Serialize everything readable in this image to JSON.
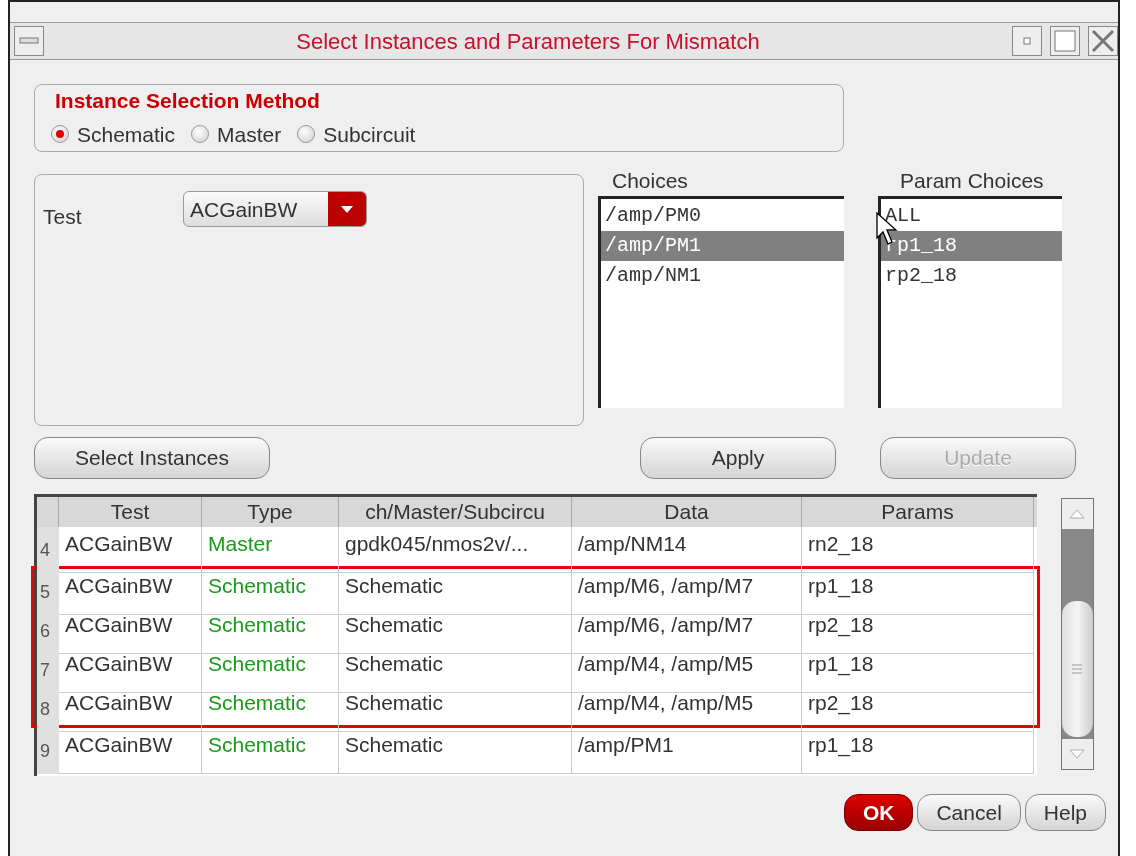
{
  "window": {
    "title": "Select Instances and Parameters For Mismatch"
  },
  "selection_method": {
    "title": "Instance Selection Method",
    "options": [
      {
        "label": "Schematic",
        "selected": true
      },
      {
        "label": "Master",
        "selected": false
      },
      {
        "label": "Subcircuit",
        "selected": false
      }
    ]
  },
  "test": {
    "label": "Test",
    "value": "ACGainBW"
  },
  "choices": {
    "title": "Choices",
    "items": [
      {
        "label": "/amp/PM0",
        "selected": false
      },
      {
        "label": "/amp/PM1",
        "selected": true
      },
      {
        "label": "/amp/NM1",
        "selected": false
      }
    ]
  },
  "param_choices": {
    "title": "Param Choices",
    "items": [
      {
        "label": "ALL",
        "selected": false
      },
      {
        "label": "rp1_18",
        "selected": true
      },
      {
        "label": "rp2_18",
        "selected": false
      }
    ]
  },
  "actions": [
    {
      "label": "Select Instances",
      "disabled": false
    },
    {
      "label": "Apply",
      "disabled": false
    },
    {
      "label": "Update",
      "disabled": true
    }
  ],
  "table": {
    "columns": [
      "Test",
      "Type",
      "ch/Master/Subcircu",
      "Data",
      "Params"
    ],
    "rows": [
      {
        "number": "4",
        "cells": [
          "ACGainBW",
          "Master",
          "gpdk045/nmos2v/...",
          "/amp/NM14",
          "rn2_18"
        ],
        "highlighted": false
      },
      {
        "number": "5",
        "cells": [
          "ACGainBW",
          "Schematic",
          "Schematic",
          "/amp/M6, /amp/M7",
          "rp1_18"
        ],
        "highlighted": true
      },
      {
        "number": "6",
        "cells": [
          "ACGainBW",
          "Schematic",
          "Schematic",
          "/amp/M6, /amp/M7",
          "rp2_18"
        ],
        "highlighted": true
      },
      {
        "number": "7",
        "cells": [
          "ACGainBW",
          "Schematic",
          "Schematic",
          "/amp/M4, /amp/M5",
          "rp1_18"
        ],
        "highlighted": true
      },
      {
        "number": "8",
        "cells": [
          "ACGainBW",
          "Schematic",
          "Schematic",
          "/amp/M4, /amp/M5",
          "rp2_18"
        ],
        "highlighted": true
      },
      {
        "number": "9",
        "cells": [
          "ACGainBW",
          "Schematic",
          "Schematic",
          "/amp/PM1",
          "rp1_18"
        ],
        "highlighted": false
      }
    ]
  },
  "footer_buttons": [
    {
      "label": "OK",
      "kind": "default"
    },
    {
      "label": "Cancel",
      "kind": "normal"
    },
    {
      "label": "Help",
      "kind": "normal"
    }
  ]
}
